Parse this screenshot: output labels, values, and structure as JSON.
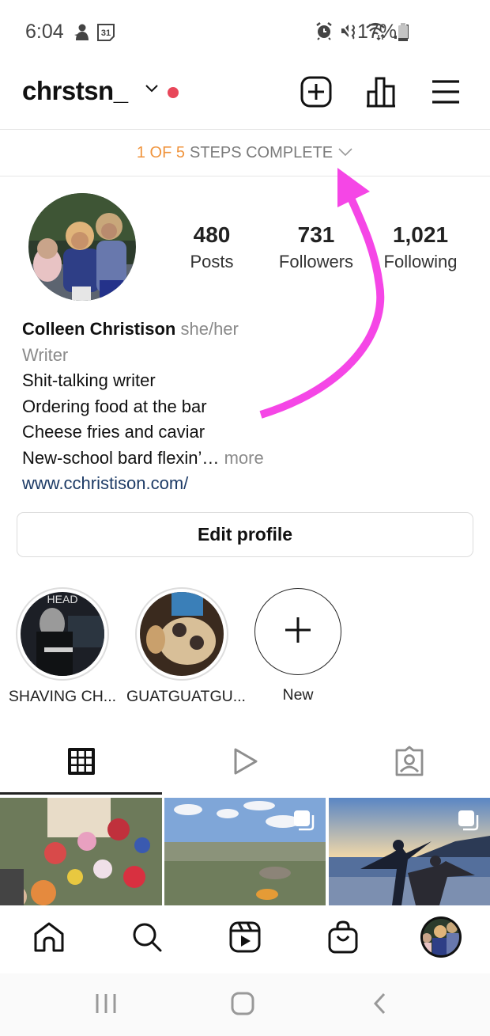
{
  "status_bar": {
    "time": "6:04",
    "left_icons": [
      "notification-app-icon",
      "calendar-icon"
    ],
    "calendar_day": "31",
    "right_icons": [
      "alarm-icon",
      "mute-icon",
      "wifi-icon",
      "signal-icon",
      "battery-icon"
    ],
    "battery_percent": "17%"
  },
  "header": {
    "username": "chrstsn_",
    "notification_dot_color": "#e8475a",
    "icons": [
      "new-post-icon",
      "insights-icon",
      "menu-icon"
    ]
  },
  "steps_banner": {
    "progress": "1 OF 5",
    "text": "STEPS COMPLETE",
    "progress_color": "#f0943d"
  },
  "profile": {
    "stats": [
      {
        "value": "480",
        "label": "Posts"
      },
      {
        "value": "731",
        "label": "Followers"
      },
      {
        "value": "1,021",
        "label": "Following"
      }
    ],
    "name": "Colleen Christison",
    "pronouns": "she/her",
    "category": "Writer",
    "bio_lines": [
      "Shit-talking writer",
      "Ordering food at the bar",
      "Cheese fries and caviar",
      "New-school bard flexin’…"
    ],
    "more_label": "more",
    "website": "www.cchristison.com/",
    "edit_button": "Edit profile"
  },
  "highlights": [
    {
      "label": "SHAVING CH..."
    },
    {
      "label": "GUATGUATGU..."
    },
    {
      "label": "New"
    }
  ],
  "tabs": [
    {
      "name": "posts-grid",
      "icon": "grid-icon",
      "active": true
    },
    {
      "name": "reels",
      "icon": "play-icon",
      "active": false
    },
    {
      "name": "tagged",
      "icon": "tagged-person-icon",
      "active": false
    }
  ],
  "grid_tiles": [
    {
      "description": "flower wall selfie",
      "multi": false
    },
    {
      "description": "jungle landscape",
      "multi": true
    },
    {
      "description": "people on frozen lake at sunset",
      "multi": true
    }
  ],
  "bottom_nav": [
    "home-icon",
    "search-icon",
    "reels-icon",
    "shop-icon",
    "profile-avatar"
  ],
  "system_nav": [
    "recent-apps-icon",
    "home-button-icon",
    "back-icon"
  ],
  "annotation": {
    "type": "arrow",
    "color": "#f546e6",
    "points_to": "steps-banner"
  }
}
